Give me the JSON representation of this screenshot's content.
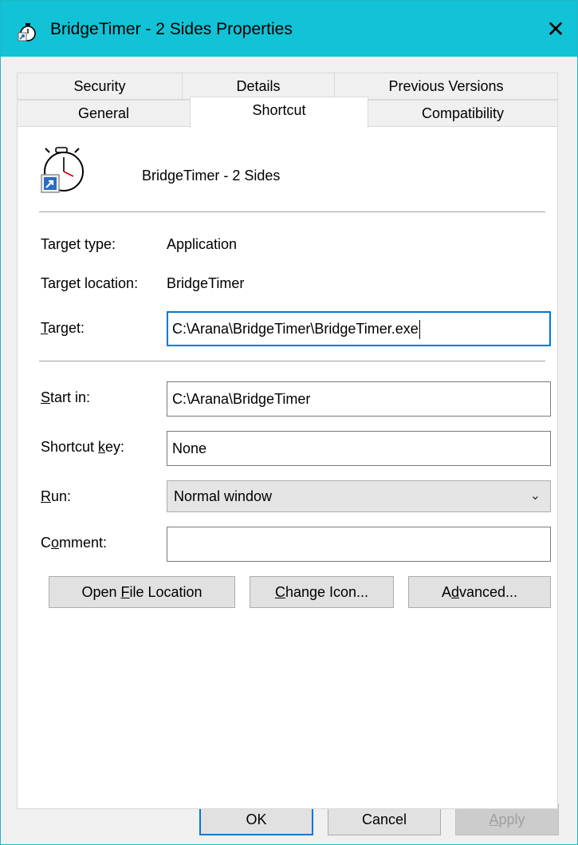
{
  "window": {
    "title": "BridgeTimer - 2 Sides Properties",
    "title_bar_color": "#12c2d6",
    "close_icon": "close-icon"
  },
  "tabs": {
    "row1": [
      "Security",
      "Details",
      "Previous Versions"
    ],
    "row2": [
      "General",
      "Shortcut",
      "Compatibility"
    ],
    "active": "Shortcut"
  },
  "shortcut": {
    "name": "BridgeTimer - 2 Sides",
    "icon": "stopwatch-shortcut-icon",
    "target_type_label": "Target type:",
    "target_type_value": "Application",
    "target_location_label": "Target location:",
    "target_location_value": "BridgeTimer",
    "target_label_pre": "",
    "target_label_ul": "T",
    "target_label_post": "arget:",
    "target_value": "C:\\Arana\\BridgeTimer\\BridgeTimer.exe",
    "start_in_label_pre": "",
    "start_in_label_ul": "S",
    "start_in_label_post": "tart in:",
    "start_in_value": "C:\\Arana\\BridgeTimer",
    "shortcut_key_label_pre": "Shortcut ",
    "shortcut_key_label_ul": "k",
    "shortcut_key_label_post": "ey:",
    "shortcut_key_value": "None",
    "run_label_pre": "",
    "run_label_ul": "R",
    "run_label_post": "un:",
    "run_value": "Normal window",
    "comment_label_pre": "C",
    "comment_label_ul": "o",
    "comment_label_post": "mment:",
    "comment_value": ""
  },
  "action_buttons": {
    "open_pre": "Open ",
    "open_ul": "F",
    "open_post": "ile Location",
    "change_pre": "",
    "change_ul": "C",
    "change_post": "hange Icon...",
    "advanced_pre": "A",
    "advanced_ul": "d",
    "advanced_post": "vanced..."
  },
  "footer": {
    "ok": "OK",
    "cancel": "Cancel",
    "apply_ul": "A",
    "apply_post": "pply",
    "accent_color": "#0078d7"
  }
}
